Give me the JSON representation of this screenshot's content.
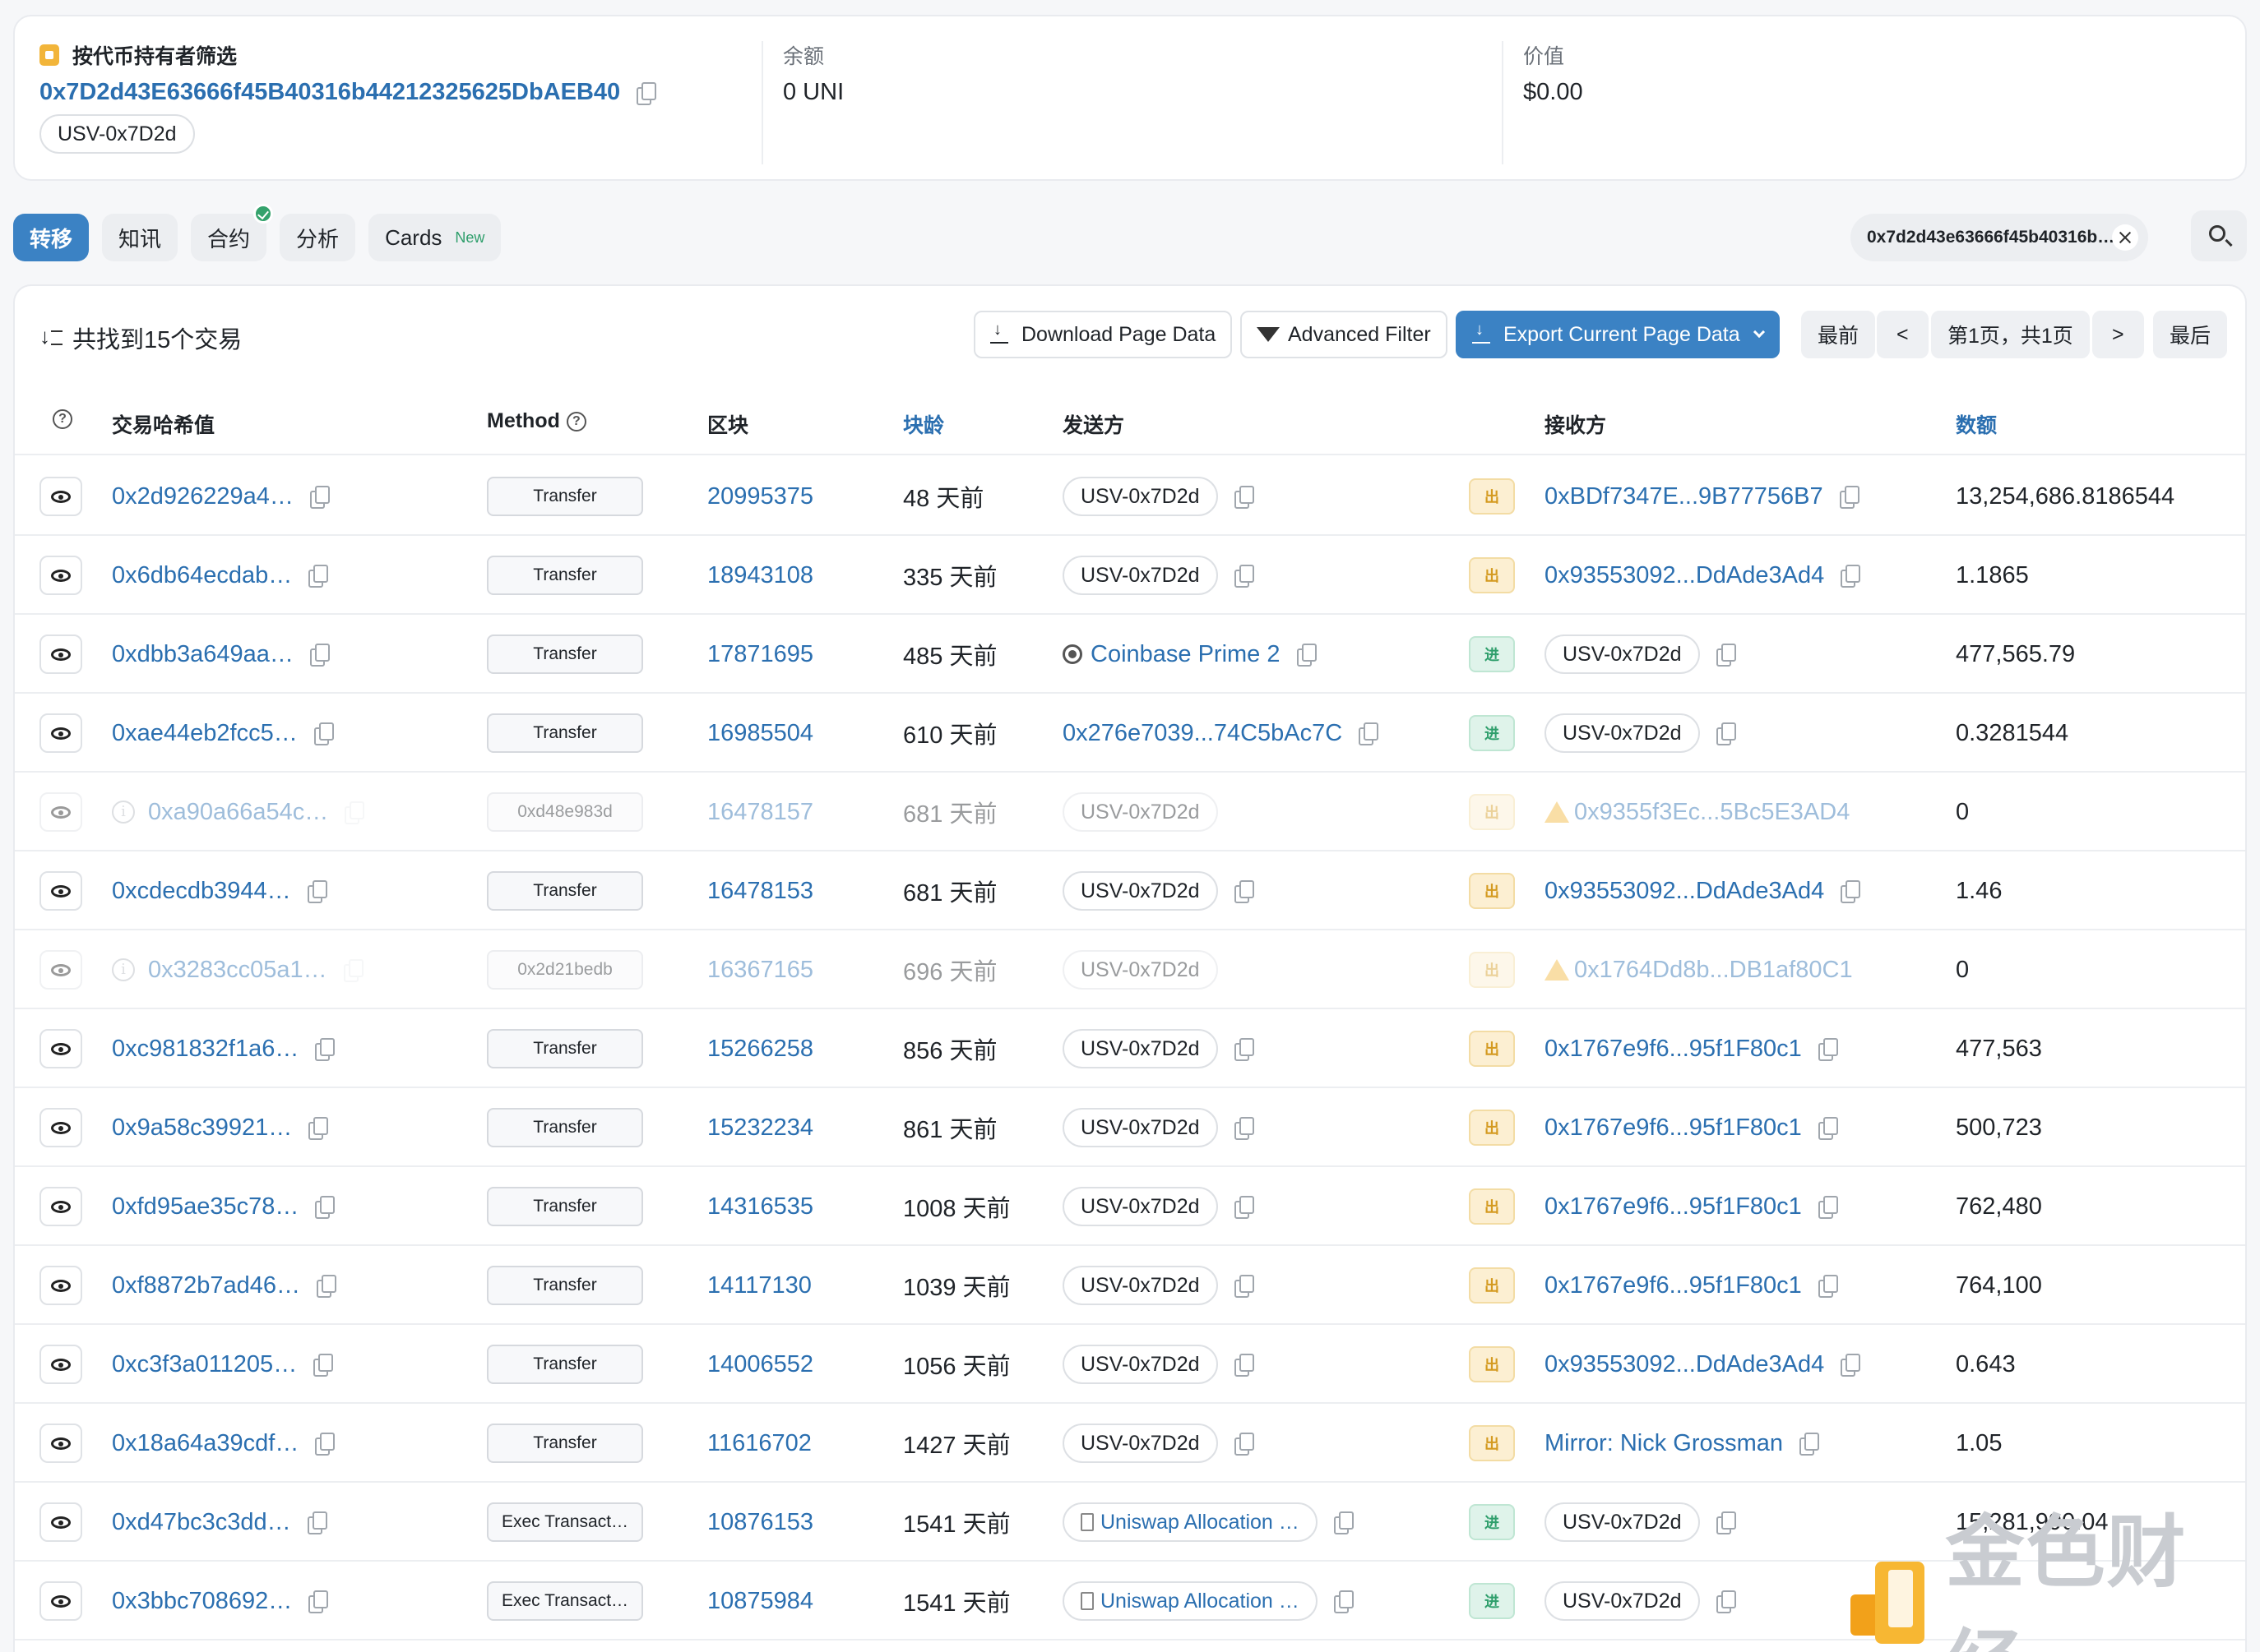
{
  "summary": {
    "filter_label": "按代币持有者筛选",
    "address": "0x7D2d43E63666f45B40316b44212325625DbAEB40",
    "tag": "USV-0x7D2d",
    "balance_label": "余额",
    "balance_value": "0 UNI",
    "value_label": "价值",
    "value_value": "$0.00"
  },
  "tabs": [
    {
      "label": "转移",
      "active": true
    },
    {
      "label": "知讯"
    },
    {
      "label": "合约",
      "verified": true
    },
    {
      "label": "分析"
    },
    {
      "label": "Cards",
      "badge": "New"
    }
  ],
  "filter_chip": {
    "text": "0x7d2d43e63666f45b40316b…"
  },
  "toolbar": {
    "found_text": "共找到15个交易",
    "download_btn": "Download Page Data",
    "advanced_btn": "Advanced Filter",
    "export_btn": "Export Current Page Data",
    "first_btn": "最前",
    "prev_btn": "<",
    "page_info": "第1页，共1页",
    "next_btn": ">",
    "last_btn": "最后"
  },
  "table": {
    "headers": {
      "hash": "交易哈希值",
      "method": "Method",
      "block": "区块",
      "age": "块龄",
      "from": "发送方",
      "to": "接收方",
      "amount": "数额"
    },
    "rows": [
      {
        "hash": "0x2d926229a4…",
        "method": "Transfer",
        "block": "20995375",
        "age": "48 天前",
        "from": "USV-0x7D2d",
        "from_type": "pill",
        "dir": "出",
        "dir_type": "out",
        "to": "0xBDf7347E...9B77756B7",
        "to_type": "link",
        "amount": "13,254,686.8186544"
      },
      {
        "hash": "0x6db64ecdab…",
        "method": "Transfer",
        "block": "18943108",
        "age": "335 天前",
        "from": "USV-0x7D2d",
        "from_type": "pill",
        "dir": "出",
        "dir_type": "out",
        "to": "0x93553092...DdAde3Ad4",
        "to_type": "link",
        "amount": "1.1865"
      },
      {
        "hash": "0xdbb3a649aa…",
        "method": "Transfer",
        "block": "17871695",
        "age": "485 天前",
        "from": "Coinbase Prime 2",
        "from_type": "coinbase",
        "dir": "进",
        "dir_type": "in",
        "to": "USV-0x7D2d",
        "to_type": "pill",
        "amount": "477,565.79"
      },
      {
        "hash": "0xae44eb2fcc5…",
        "method": "Transfer",
        "block": "16985504",
        "age": "610 天前",
        "from": "0x276e7039...74C5bAc7C",
        "from_type": "link",
        "dir": "进",
        "dir_type": "in",
        "to": "USV-0x7D2d",
        "to_type": "pill",
        "amount": "0.3281544"
      },
      {
        "hash": "0xa90a66a54c…",
        "method": "0xd48e983d",
        "block": "16478157",
        "age": "681 天前",
        "from": "USV-0x7D2d",
        "from_type": "pill",
        "dir": "出",
        "dir_type": "out",
        "to": "0x9355f3Ec...5Bc5E3AD4",
        "to_type": "warn",
        "amount": "0",
        "faded": true
      },
      {
        "hash": "0xcdecdb3944…",
        "method": "Transfer",
        "block": "16478153",
        "age": "681 天前",
        "from": "USV-0x7D2d",
        "from_type": "pill",
        "dir": "出",
        "dir_type": "out",
        "to": "0x93553092...DdAde3Ad4",
        "to_type": "link",
        "amount": "1.46"
      },
      {
        "hash": "0x3283cc05a1…",
        "method": "0x2d21bedb",
        "block": "16367165",
        "age": "696 天前",
        "from": "USV-0x7D2d",
        "from_type": "pill",
        "dir": "出",
        "dir_type": "out",
        "to": "0x1764Dd8b...DB1af80C1",
        "to_type": "warn",
        "amount": "0",
        "faded": true
      },
      {
        "hash": "0xc981832f1a6…",
        "method": "Transfer",
        "block": "15266258",
        "age": "856 天前",
        "from": "USV-0x7D2d",
        "from_type": "pill",
        "dir": "出",
        "dir_type": "out",
        "to": "0x1767e9f6...95f1F80c1",
        "to_type": "link",
        "amount": "477,563"
      },
      {
        "hash": "0x9a58c39921…",
        "method": "Transfer",
        "block": "15232234",
        "age": "861 天前",
        "from": "USV-0x7D2d",
        "from_type": "pill",
        "dir": "出",
        "dir_type": "out",
        "to": "0x1767e9f6...95f1F80c1",
        "to_type": "link",
        "amount": "500,723"
      },
      {
        "hash": "0xfd95ae35c78…",
        "method": "Transfer",
        "block": "14316535",
        "age": "1008 天前",
        "from": "USV-0x7D2d",
        "from_type": "pill",
        "dir": "出",
        "dir_type": "out",
        "to": "0x1767e9f6...95f1F80c1",
        "to_type": "link",
        "amount": "762,480"
      },
      {
        "hash": "0xf8872b7ad46…",
        "method": "Transfer",
        "block": "14117130",
        "age": "1039 天前",
        "from": "USV-0x7D2d",
        "from_type": "pill",
        "dir": "出",
        "dir_type": "out",
        "to": "0x1767e9f6...95f1F80c1",
        "to_type": "link",
        "amount": "764,100"
      },
      {
        "hash": "0xc3f3a011205…",
        "method": "Transfer",
        "block": "14006552",
        "age": "1056 天前",
        "from": "USV-0x7D2d",
        "from_type": "pill",
        "dir": "出",
        "dir_type": "out",
        "to": "0x93553092...DdAde3Ad4",
        "to_type": "link",
        "amount": "0.643"
      },
      {
        "hash": "0x18a64a39cdf…",
        "method": "Transfer",
        "block": "11616702",
        "age": "1427 天前",
        "from": "USV-0x7D2d",
        "from_type": "pill",
        "dir": "出",
        "dir_type": "out",
        "to": "Mirror: Nick Grossman",
        "to_type": "link",
        "amount": "1.05"
      },
      {
        "hash": "0xd47bc3c3dd…",
        "method": "Exec Transact…",
        "block": "10876153",
        "age": "1541 天前",
        "from": "Uniswap Allocation …",
        "from_type": "doc",
        "dir": "进",
        "dir_type": "in",
        "to": "USV-0x7D2d",
        "to_type": "pill",
        "amount": "15,281,990.04"
      },
      {
        "hash": "0x3bbc708692…",
        "method": "Exec Transact…",
        "block": "10875984",
        "age": "1541 天前",
        "from": "Uniswap Allocation …",
        "from_type": "doc",
        "dir": "进",
        "dir_type": "in",
        "to": "USV-0x7D2d",
        "to_type": "pill",
        "amount": ""
      }
    ]
  },
  "watermark": {
    "text": "金色财经"
  }
}
